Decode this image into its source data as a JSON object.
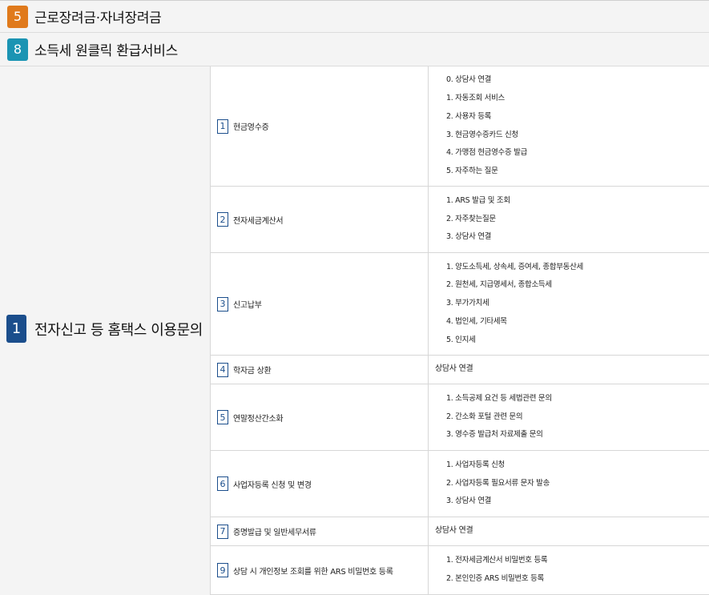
{
  "headers": [
    {
      "number": "5",
      "title": "근로장려금·자녀장려금",
      "color": "#e07a1c"
    },
    {
      "number": "8",
      "title": "소득세 원클릭 환급서비스",
      "color": "#1b94b3"
    }
  ],
  "main": {
    "number": "1",
    "title": "전자신고 등 홈택스 이용문의",
    "color": "#1b4e8c"
  },
  "rows": [
    {
      "number": "1",
      "label": "현금영수증",
      "items": [
        "0. 상담사 연결",
        "1. 자동조회 서비스",
        "2. 사용자 등록",
        "3. 현금영수증카드 신청",
        "4. 가맹점 현금영수증 발급",
        "5. 자주하는 질문"
      ]
    },
    {
      "number": "2",
      "label": "전자세금계산서",
      "items": [
        "1. ARS 발급 및 조회",
        "2. 자주찾는질문",
        "3. 상담사 연결"
      ]
    },
    {
      "number": "3",
      "label": "신고납부",
      "items": [
        "1. 양도소득세, 상속세, 증여세, 종합부동산세",
        "2. 원천세, 지급명세서, 종합소득세",
        "3. 부가가치세",
        "4. 법인세, 기타세목",
        "5. 인지세"
      ]
    },
    {
      "number": "4",
      "label": "학자금 상환",
      "items": [
        "상담사 연결"
      ]
    },
    {
      "number": "5",
      "label": "연말정산간소화",
      "items": [
        "1. 소득공제 요건 등 세법관련 문의",
        "2. 간소화 포털 관련 문의",
        "3. 영수증 발급처 자료제출 문의"
      ]
    },
    {
      "number": "6",
      "label": "사업자등록 신청 및 변경",
      "items": [
        "1. 사업자등록 신청",
        "2. 사업자등록 필요서류 문자 발송",
        "3. 상담사 연결"
      ]
    },
    {
      "number": "7",
      "label": "증명발급 및 일반세무서류",
      "items": [
        "상담사 연결"
      ]
    },
    {
      "number": "9",
      "label": "상담 시 개인정보 조회를 위한 ARS 비밀번호 등록",
      "items": [
        "1. 전자세금계산서 비밀번호 등록",
        "2. 본인인증 ARS 비밀번호 등록"
      ]
    }
  ]
}
